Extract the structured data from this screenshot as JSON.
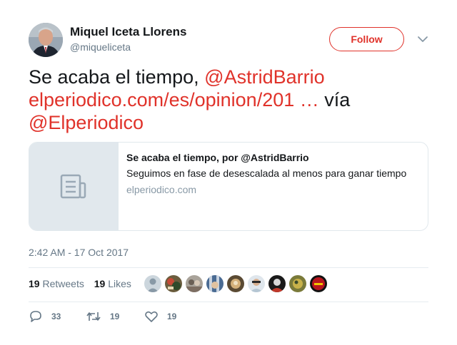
{
  "author": {
    "name": "Miquel Iceta Llorens",
    "handle": "@miqueliceta"
  },
  "follow_label": "Follow",
  "tweet": {
    "t1": "Se acaba el tiempo, ",
    "mention1": "@AstridBarrio",
    "url": "elperiodico.com/es/opinion/201 …",
    "t2": " vía ",
    "mention2": "@Elperiodico"
  },
  "card": {
    "title": "Se acaba el tiempo, por @AstridBarrio",
    "description": "Seguimos en fase de desescalada al menos para ganar tiempo",
    "domain": "elperiodico.com"
  },
  "timestamp": "2:42 AM - 17 Oct 2017",
  "stats": {
    "retweets_count": "19",
    "retweets_label": "Retweets",
    "likes_count": "19",
    "likes_label": "Likes"
  },
  "actions": {
    "reply_count": "33",
    "retweet_count": "19",
    "like_count": "19"
  },
  "colors": {
    "accent": "#e0322a",
    "secondary_text": "#657786",
    "border": "#e1e8ed"
  }
}
